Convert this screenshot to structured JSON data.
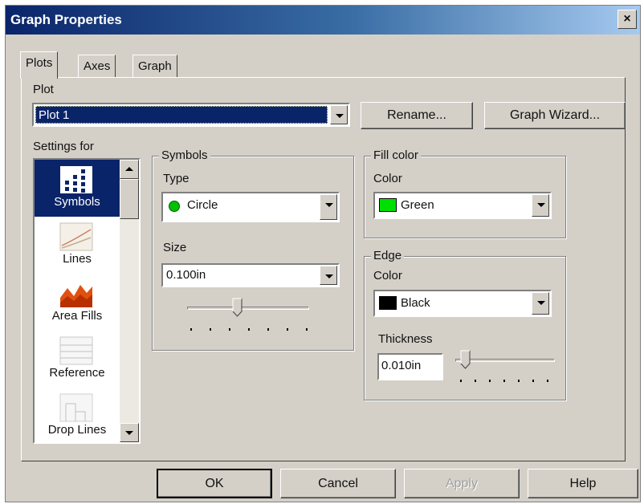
{
  "window": {
    "title": "Graph Properties",
    "close_label": "×"
  },
  "tabs": [
    {
      "label": "Plots",
      "active": true
    },
    {
      "label": "Axes",
      "active": false
    },
    {
      "label": "Graph",
      "active": false
    }
  ],
  "plot": {
    "label": "Plot",
    "selected": "Plot 1",
    "rename_label": "Rename...",
    "wizard_label": "Graph Wizard..."
  },
  "settings": {
    "label": "Settings for",
    "items": [
      {
        "label": "Symbols",
        "icon": "symbols-icon",
        "selected": true
      },
      {
        "label": "Lines",
        "icon": "lines-icon",
        "selected": false
      },
      {
        "label": "Area Fills",
        "icon": "area-fills-icon",
        "selected": false
      },
      {
        "label": "Reference",
        "icon": "reference-icon",
        "selected": false
      },
      {
        "label": "Drop Lines",
        "icon": "drop-lines-icon",
        "selected": false
      }
    ]
  },
  "symbols": {
    "group_title": "Symbols",
    "type_label": "Type",
    "type_value": "Circle",
    "type_color": "#00c000",
    "size_label": "Size",
    "size_value": "0.100in",
    "size_slider_fraction": 0.4
  },
  "fill": {
    "group_title": "Fill color",
    "color_label": "Color",
    "color_value": "Green",
    "color_hex": "#00e000"
  },
  "edge": {
    "group_title": "Edge",
    "color_label": "Color",
    "color_value": "Black",
    "color_hex": "#000000",
    "thickness_label": "Thickness",
    "thickness_value": "0.010in",
    "thickness_slider_fraction": 0.05
  },
  "buttons": {
    "ok": "OK",
    "cancel": "Cancel",
    "apply": "Apply",
    "help": "Help"
  }
}
